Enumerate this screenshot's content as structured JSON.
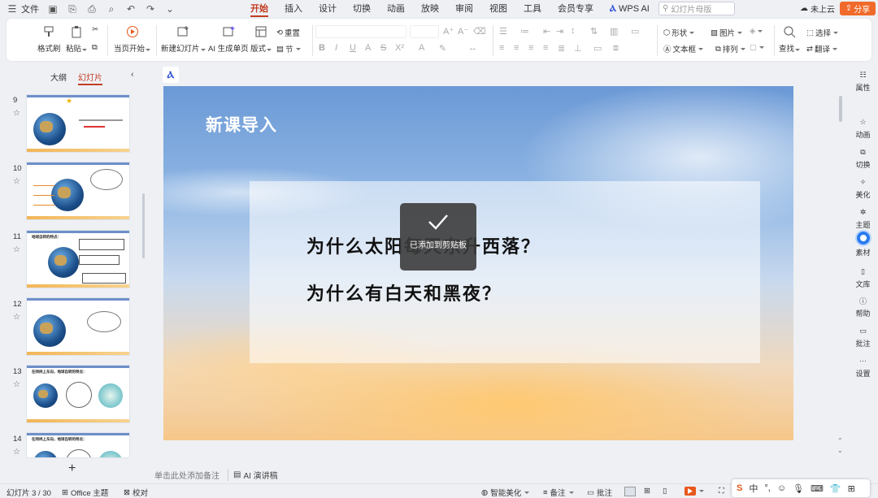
{
  "menubar": {
    "file_label": "文件",
    "tabs": [
      "开始",
      "插入",
      "设计",
      "切换",
      "动画",
      "放映",
      "审阅",
      "视图",
      "工具",
      "会员专享",
      "WPS AI"
    ],
    "active_tab": "开始",
    "search_placeholder": "幻灯片母版",
    "cloud_label": "未上云",
    "share_label": "分享"
  },
  "ribbon": {
    "format_painter": "格式刷",
    "paste": "粘贴",
    "from_current": "当页开始",
    "new_slide": "新建幻灯片",
    "ai_slide": "AI 生成单页",
    "layout": "版式",
    "reset": "重置",
    "section": "节",
    "shape": "形状",
    "picture": "图片",
    "textbox": "文本框",
    "arrange": "排列",
    "find": "查找",
    "select": "选择",
    "translate": "翻译"
  },
  "left_panel": {
    "tab_outline": "大纲",
    "tab_slides": "幻灯片",
    "slides": [
      {
        "num": "9"
      },
      {
        "num": "10"
      },
      {
        "num": "11",
        "title": "地球自转的特点："
      },
      {
        "num": "12"
      },
      {
        "num": "13",
        "title": "在同纬上东向，地球自转的特点："
      },
      {
        "num": "14",
        "title": "在同纬上东向，地球自转的特点："
      }
    ]
  },
  "slide": {
    "title": "新课导入",
    "question1": "为什么太阳每天东升西落？",
    "question2": "为什么有白天和黑夜？",
    "toast": "已添加到剪贴板"
  },
  "right_sidebar": [
    "属性",
    "动画",
    "切换",
    "美化",
    "主题",
    "素材",
    "文库",
    "帮助",
    "批注",
    "设置"
  ],
  "notes": {
    "placeholder": "单击此处添加备注",
    "ai_speech": "AI 演讲稿"
  },
  "status": {
    "slide_count": "幻灯片 3 / 30",
    "theme": "Office 主题",
    "proof": "校对",
    "beautify": "智能美化",
    "notes": "备注",
    "comments": "批注"
  },
  "ime": {
    "lang": "中"
  },
  "colors": {
    "accent": "#c33d22",
    "share": "#f06b2b",
    "sidebar_active": "#2b7cf0"
  }
}
